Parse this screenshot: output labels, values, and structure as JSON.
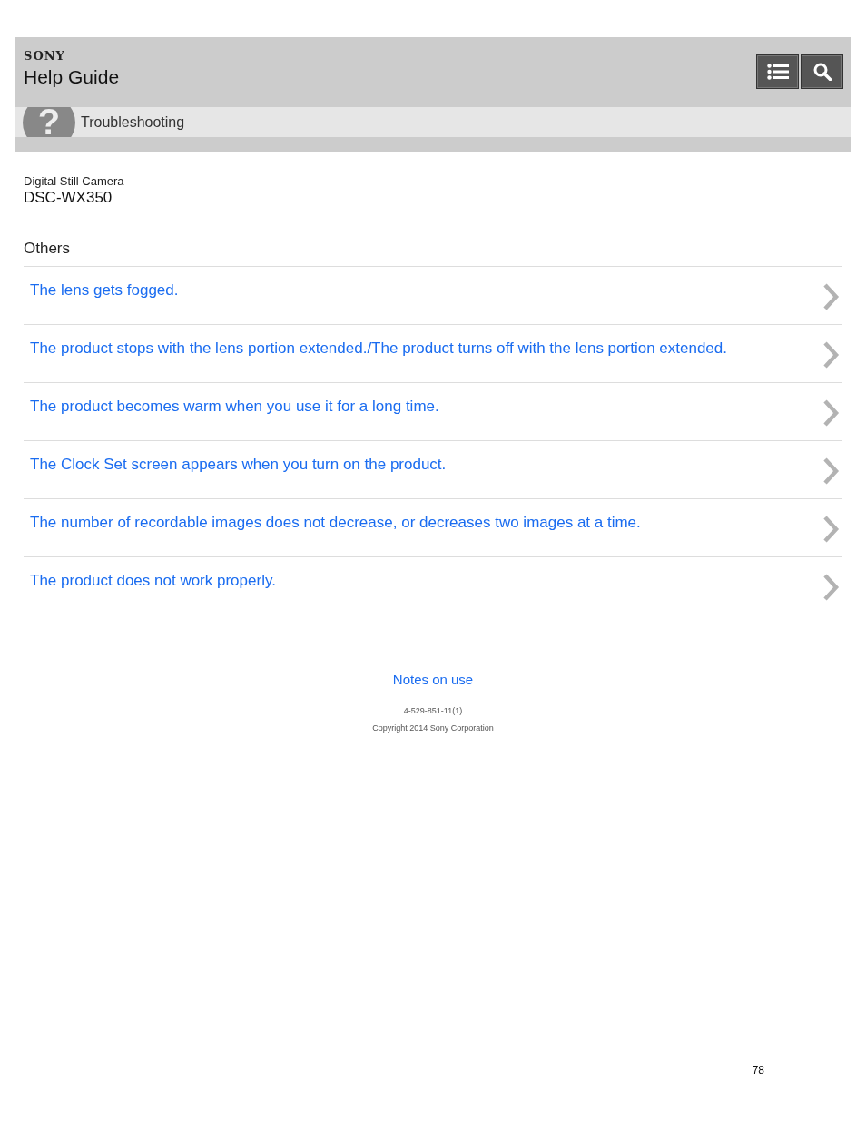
{
  "header": {
    "brand": "SONY",
    "title": "Help Guide",
    "buttons": [
      {
        "kind": "list"
      },
      {
        "kind": "search"
      }
    ]
  },
  "breadcrumb": {
    "icon_glyph": "?",
    "label": "Troubleshooting"
  },
  "product": {
    "category": "Digital Still Camera",
    "model": "DSC-WX350"
  },
  "section": {
    "title": "Others",
    "links": [
      {
        "text": "The lens gets fogged."
      },
      {
        "text": "The product stops with the lens portion extended./The product turns off with the lens portion extended."
      },
      {
        "text": "The product becomes warm when you use it for a long time."
      },
      {
        "text": "The Clock Set screen appears when you turn on the product."
      },
      {
        "text": "The number of recordable images does not decrease, or decreases two images at a time."
      },
      {
        "text": "The product does not work properly."
      }
    ]
  },
  "footer": {
    "link": "Notes on use",
    "code": "4-529-851-11(1)",
    "copyright": "Copyright 2014 Sony Corporation"
  },
  "page_number": "78"
}
